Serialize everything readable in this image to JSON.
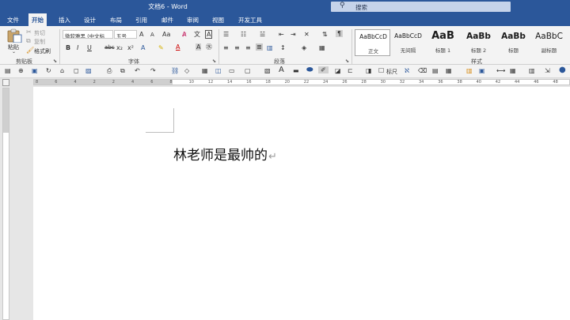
{
  "window": {
    "title": "文档6 - Word"
  },
  "search": {
    "label": "搜索"
  },
  "tabs": [
    {
      "label": "文件"
    },
    {
      "label": "开始"
    },
    {
      "label": "插入"
    },
    {
      "label": "设计"
    },
    {
      "label": "布局"
    },
    {
      "label": "引用"
    },
    {
      "label": "邮件"
    },
    {
      "label": "审阅"
    },
    {
      "label": "视图"
    },
    {
      "label": "开发工具"
    }
  ],
  "clipboard": {
    "paste": "粘贴",
    "cut": "剪切",
    "copy": "复制",
    "format_painter": "格式刷",
    "group": "剪贴板"
  },
  "font": {
    "name": "微软雅黑 (中文标",
    "size": "五号",
    "group": "字体",
    "grow": "A",
    "shrink": "A",
    "case": "Aa",
    "bold": "B",
    "italic": "I",
    "underline": "U",
    "strike": "abc",
    "subscript": "x₂",
    "superscript": "x²",
    "text_effect": "A",
    "font_color": "A",
    "shading": "A",
    "border_char": "A"
  },
  "paragraph": {
    "group": "段落"
  },
  "styles": {
    "group": "样式",
    "items": [
      {
        "sample": "AaBbCcD",
        "name": "正文"
      },
      {
        "sample": "AaBbCcD",
        "name": "无间隔"
      },
      {
        "sample": "AaB",
        "name": "标题 1"
      },
      {
        "sample": "AaBb",
        "name": "标题 2"
      },
      {
        "sample": "AaBb",
        "name": "标题"
      },
      {
        "sample": "AaBbC",
        "name": "副标题"
      }
    ]
  },
  "qat": {
    "ruler_label": "标尺"
  },
  "ruler": {
    "numbers": [
      "8",
      "6",
      "4",
      "2",
      "2",
      "4",
      "6",
      "8",
      "10",
      "12",
      "14",
      "16",
      "18",
      "20",
      "22",
      "24",
      "26",
      "28",
      "30",
      "32",
      "34",
      "36",
      "38",
      "40",
      "42",
      "44",
      "46",
      "48"
    ]
  },
  "document": {
    "text": "林老师是最帅的",
    "pilcrow": "↵"
  }
}
